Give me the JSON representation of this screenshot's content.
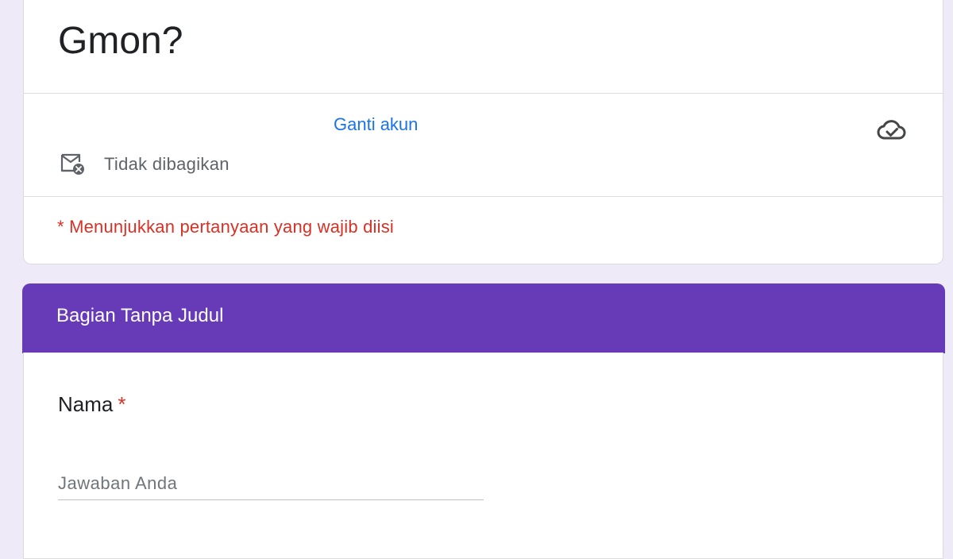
{
  "form": {
    "title": "Gmon?"
  },
  "account": {
    "switch_label": "Ganti akun",
    "email_status": "Tidak dibagikan",
    "save_status_icon": "cloud-check-icon"
  },
  "notice": {
    "required_text": "* Menunjukkan pertanyaan yang wajib diisi"
  },
  "section": {
    "title": "Bagian Tanpa Judul"
  },
  "question": {
    "label": "Nama",
    "required_marker": "*",
    "placeholder": "Jawaban Anda"
  },
  "colors": {
    "accent": "#673ab7",
    "link": "#1a73e8",
    "required": "#d93025",
    "background": "#efeaf8"
  }
}
